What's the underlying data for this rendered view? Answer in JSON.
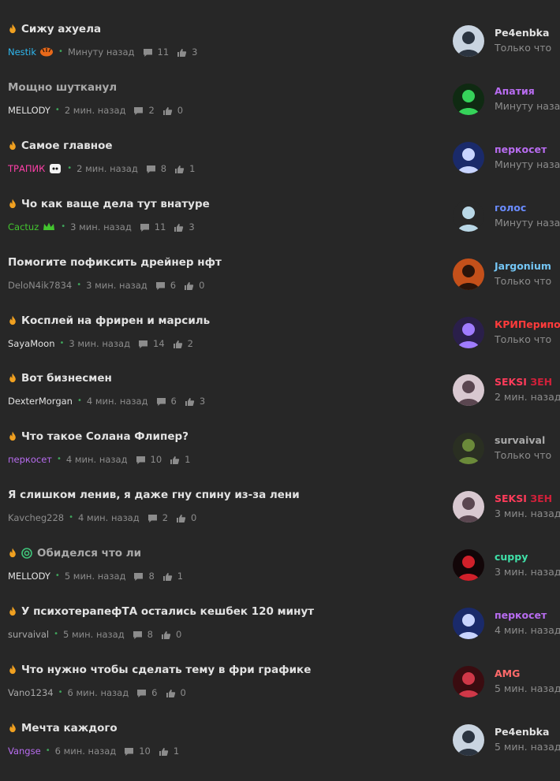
{
  "colors": {
    "background": "#272727",
    "title_active": "#e2e2e2",
    "title_read": "#a9a9a9",
    "meta": "#8c8c8c",
    "flame": "#f0a020",
    "online_dot": "#3fa55b"
  },
  "threads": [
    {
      "title": "Сижу ахуела",
      "read": false,
      "flame": true,
      "target": false,
      "author": "Nestik",
      "author_color": "#2fb8f0",
      "author_badge": "tiger-badge-icon",
      "time": "Минуту назад",
      "replies": "11",
      "likes": "3",
      "last_user": "Pe4enbka",
      "last_user_color": "#e2e2e2",
      "last_time": "Только что",
      "avatar_colors": [
        "#c9d4e0",
        "#2b3440"
      ]
    },
    {
      "title": "Мощно шутканул",
      "read": true,
      "flame": false,
      "target": false,
      "author": "MELLODY",
      "author_color": "#e2e2e2",
      "author_badge": "",
      "time": "2 мин. назад",
      "replies": "2",
      "likes": "0",
      "last_user": "Апатия",
      "last_user_color": "#b86cf0",
      "last_time": "Минуту назад",
      "avatar_colors": [
        "#0f2a12",
        "#36d35a"
      ]
    },
    {
      "title": "Самое главное",
      "read": false,
      "flame": true,
      "target": false,
      "author": "ТРАПИК",
      "author_color": "#ff3fa8",
      "author_badge": "face-badge-icon",
      "time": "2 мин. назад",
      "replies": "8",
      "likes": "1",
      "last_user": "перкосет",
      "last_user_color": "#b86cf0",
      "last_time": "Минуту назад",
      "avatar_colors": [
        "#1a2a6a",
        "#c8d4ff"
      ]
    },
    {
      "title": "Чо как ваще дела тут внатуре",
      "read": false,
      "flame": true,
      "target": false,
      "author": "Cactuz",
      "author_color": "#43c42f",
      "author_badge": "crown-badge-icon",
      "time": "3 мин. назад",
      "replies": "11",
      "likes": "3",
      "last_user": "голос",
      "last_user_color": "#6a8cff",
      "last_time": "Минуту назад",
      "avatar_colors": [
        "#272727",
        "#b9d7e6"
      ]
    },
    {
      "title": "Помогите пофиксить дрейнер нфт",
      "read": false,
      "flame": false,
      "target": false,
      "author": "DeloN4ik7834",
      "author_color": "#8c8c8c",
      "author_badge": "",
      "time": "3 мин. назад",
      "replies": "6",
      "likes": "0",
      "last_user": "Jargonium",
      "last_user_color": "#74c6f5",
      "last_time": "Только что",
      "avatar_colors": [
        "#c4501a",
        "#2a140a"
      ]
    },
    {
      "title": "Косплей на фрирен и марсиль",
      "read": false,
      "flame": true,
      "target": false,
      "author": "SayaMoon",
      "author_color": "#e2e2e2",
      "author_badge": "",
      "time": "3 мин. назад",
      "replies": "14",
      "likes": "2",
      "last_user": "КРИПерипоч",
      "last_user_color": "#ff3b3b",
      "last_time": "Только что",
      "avatar_colors": [
        "#2a1f4a",
        "#a07cff"
      ]
    },
    {
      "title": "Вот бизнесмен",
      "read": false,
      "flame": true,
      "target": false,
      "author": "DexterMorgan",
      "author_color": "#e2e2e2",
      "author_badge": "",
      "time": "4 мин. назад",
      "replies": "6",
      "likes": "3",
      "last_user": "SEKSI",
      "last_user_color": "#ff3b5a",
      "last_user_extra": "ЗЕН",
      "last_time": "2 мин. назад",
      "avatar_colors": [
        "#d8c8d0",
        "#5a4650"
      ]
    },
    {
      "title": "Что такое Солана Флипер?",
      "read": false,
      "flame": true,
      "target": false,
      "author": "перкосет",
      "author_color": "#b86cf0",
      "author_badge": "",
      "time": "4 мин. назад",
      "replies": "10",
      "likes": "1",
      "last_user": "survaival",
      "last_user_color": "#a9a9a9",
      "last_time": "Только что",
      "avatar_colors": [
        "#2a2f22",
        "#6b8a3a"
      ]
    },
    {
      "title": "Я слишком ленив, я даже гну спину из-за лени",
      "read": false,
      "flame": false,
      "target": false,
      "author": "Kavcheg228",
      "author_color": "#8c8c8c",
      "author_badge": "",
      "time": "4 мин. назад",
      "replies": "2",
      "likes": "0",
      "last_user": "SEKSI",
      "last_user_color": "#ff3b5a",
      "last_user_extra": "ЗЕН",
      "last_time": "3 мин. назад",
      "avatar_colors": [
        "#d8c8d0",
        "#5a4650"
      ]
    },
    {
      "title": "Обиделся что ли",
      "read": true,
      "flame": true,
      "target": true,
      "author": "MELLODY",
      "author_color": "#e2e2e2",
      "author_badge": "",
      "time": "5 мин. назад",
      "replies": "8",
      "likes": "1",
      "last_user": "cuppy",
      "last_user_color": "#3fe0a8",
      "last_time": "3 мин. назад",
      "avatar_colors": [
        "#120608",
        "#d0202a"
      ]
    },
    {
      "title": "У психотерапефТА остались кешбек 120 минут",
      "read": false,
      "flame": true,
      "target": false,
      "author": "survaival",
      "author_color": "#a9a9a9",
      "author_badge": "",
      "time": "5 мин. назад",
      "replies": "8",
      "likes": "0",
      "last_user": "перкосет",
      "last_user_color": "#b86cf0",
      "last_time": "4 мин. назад",
      "avatar_colors": [
        "#1a2a6a",
        "#c8d4ff"
      ]
    },
    {
      "title": "Что нужно чтобы сделать тему в фри графике",
      "read": false,
      "flame": true,
      "target": false,
      "author": "Vano1234",
      "author_color": "#a9a9a9",
      "author_badge": "",
      "time": "6 мин. назад",
      "replies": "6",
      "likes": "0",
      "last_user": "AMG",
      "last_user_color": "#ff6a6a",
      "last_time": "5 мин. назад",
      "avatar_colors": [
        "#3a0c10",
        "#d03848"
      ]
    },
    {
      "title": "Мечта каждого",
      "read": false,
      "flame": true,
      "target": false,
      "author": "Vangse",
      "author_color": "#b86cf0",
      "author_badge": "",
      "time": "6 мин. назад",
      "replies": "10",
      "likes": "1",
      "last_user": "Pe4enbka",
      "last_user_color": "#e2e2e2",
      "last_time": "5 мин. назад",
      "avatar_colors": [
        "#c9d4e0",
        "#2b3440"
      ]
    }
  ]
}
